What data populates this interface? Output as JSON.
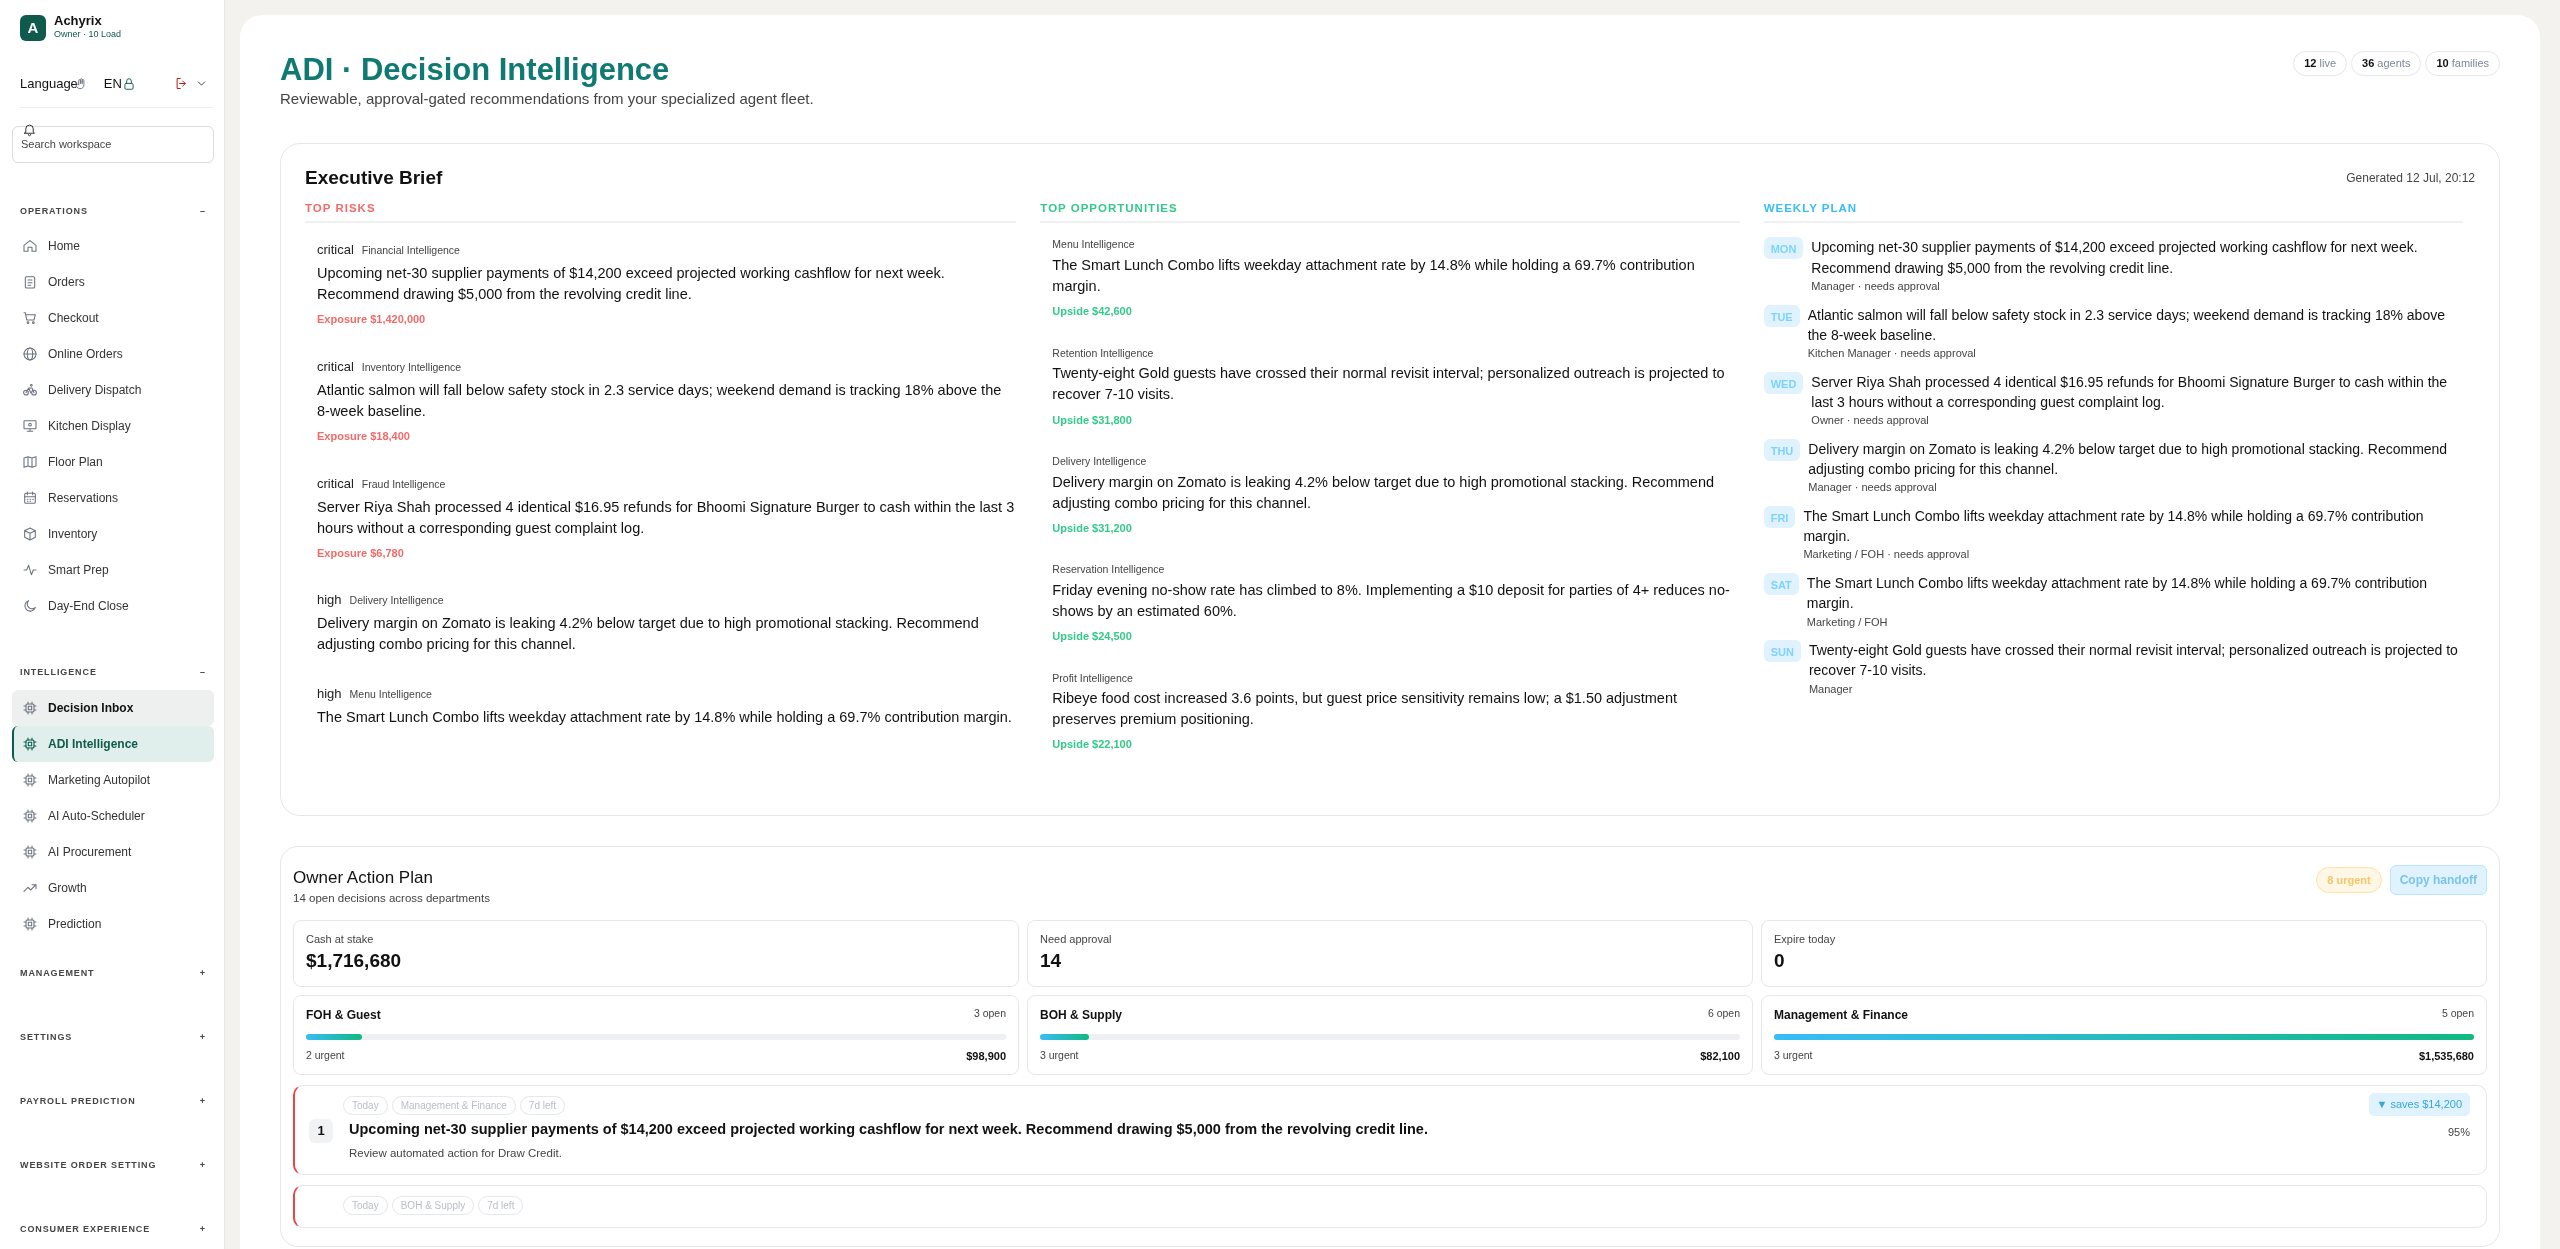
{
  "sidebar": {
    "brand": {
      "initial": "A",
      "name": "Achyrix",
      "subtitle": "Owner · 10 Load"
    },
    "language_label": "Language",
    "language_value": "EN",
    "search": {
      "placeholder": "Search workspace"
    },
    "sections": [
      {
        "title": "OPERATIONS",
        "toggle": "–",
        "items": [
          {
            "label": "Home",
            "kind": "home",
            "selected": false,
            "hovered": false
          },
          {
            "label": "Orders",
            "kind": "clipboard",
            "selected": false,
            "hovered": false
          },
          {
            "label": "Checkout",
            "kind": "cart",
            "selected": false,
            "hovered": false
          },
          {
            "label": "Online Orders",
            "kind": "globe",
            "selected": false,
            "hovered": false
          },
          {
            "label": "Delivery Dispatch",
            "kind": "bike",
            "selected": false,
            "hovered": false
          },
          {
            "label": "Kitchen Display",
            "kind": "monitor",
            "selected": false,
            "hovered": false
          },
          {
            "label": "Floor Plan",
            "kind": "map",
            "selected": false,
            "hovered": false
          },
          {
            "label": "Reservations",
            "kind": "calendar",
            "selected": false,
            "hovered": false
          },
          {
            "label": "Inventory",
            "kind": "box",
            "selected": false,
            "hovered": false
          },
          {
            "label": "Smart Prep",
            "kind": "pulse",
            "selected": false,
            "hovered": false
          },
          {
            "label": "Day-End Close",
            "kind": "moon",
            "selected": false,
            "hovered": false
          }
        ]
      },
      {
        "title": "INTELLIGENCE",
        "toggle": "–",
        "items": [
          {
            "label": "Decision Inbox",
            "kind": "chip",
            "selected": false,
            "hovered": true
          },
          {
            "label": "ADI Intelligence",
            "kind": "chip",
            "selected": true,
            "hovered": false
          },
          {
            "label": "Marketing Autopilot",
            "kind": "chip",
            "selected": false,
            "hovered": false
          },
          {
            "label": "AI Auto-Scheduler",
            "kind": "chip",
            "selected": false,
            "hovered": false
          },
          {
            "label": "AI Procurement",
            "kind": "chip",
            "selected": false,
            "hovered": false
          },
          {
            "label": "Growth",
            "kind": "trend",
            "selected": false,
            "hovered": false
          },
          {
            "label": "Prediction",
            "kind": "chip",
            "selected": false,
            "hovered": false
          }
        ]
      },
      {
        "title": "MANAGEMENT",
        "toggle": "+"
      },
      {
        "title": "SETTINGS",
        "toggle": "+"
      },
      {
        "title": "PAYROLL PREDICTION",
        "toggle": "+"
      },
      {
        "title": "WEBSITE ORDER SETTING",
        "toggle": "+"
      },
      {
        "title": "CONSUMER EXPERIENCE",
        "toggle": "+"
      }
    ]
  },
  "header": {
    "title": "ADI · Decision Intelligence",
    "subtitle": "Reviewable, approval-gated recommendations from your specialized agent fleet.",
    "stats": [
      {
        "value": "12",
        "label": "live"
      },
      {
        "value": "36",
        "label": "agents"
      },
      {
        "value": "10",
        "label": "families"
      }
    ]
  },
  "executive_brief": {
    "title": "Executive Brief",
    "generated": "Generated 12 Jul, 20:12",
    "top_risks": {
      "heading": "TOP RISKS",
      "items": [
        {
          "severity": "critical",
          "source": "Financial Intelligence",
          "text": "Upcoming net-30 supplier payments of $14,200 exceed projected working cashflow for next week. Recommend drawing $5,000 from the revolving credit line.",
          "metric": "Exposure $1,420,000"
        },
        {
          "severity": "critical",
          "source": "Inventory Intelligence",
          "text": "Atlantic salmon will fall below safety stock in 2.3 service days; weekend demand is tracking 18% above the 8-week baseline.",
          "metric": "Exposure $18,400"
        },
        {
          "severity": "critical",
          "source": "Fraud Intelligence",
          "text": "Server Riya Shah processed 4 identical $16.95 refunds for Bhoomi Signature Burger to cash within the last 3 hours without a corresponding guest complaint log.",
          "metric": "Exposure $6,780"
        },
        {
          "severity": "high",
          "source": "Delivery Intelligence",
          "text": "Delivery margin on Zomato is leaking 4.2% below target due to high promotional stacking. Recommend adjusting combo pricing for this channel."
        },
        {
          "severity": "high",
          "source": "Menu Intelligence",
          "text": "The Smart Lunch Combo lifts weekday attachment rate by 14.8% while holding a 69.7% contribution margin."
        }
      ]
    },
    "top_opportunities": {
      "heading": "TOP OPPORTUNITIES",
      "items": [
        {
          "source": "Menu Intelligence",
          "text": "The Smart Lunch Combo lifts weekday attachment rate by 14.8% while holding a 69.7% contribution margin.",
          "metric": "Upside $42,600"
        },
        {
          "source": "Retention Intelligence",
          "text": "Twenty-eight Gold guests have crossed their normal revisit interval; personalized outreach is projected to recover 7-10 visits.",
          "metric": "Upside $31,800"
        },
        {
          "source": "Delivery Intelligence",
          "text": "Delivery margin on Zomato is leaking 4.2% below target due to high promotional stacking. Recommend adjusting combo pricing for this channel.",
          "metric": "Upside $31,200"
        },
        {
          "source": "Reservation Intelligence",
          "text": "Friday evening no-show rate has climbed to 8%. Implementing a $10 deposit for parties of 4+ reduces no-shows by an estimated 60%.",
          "metric": "Upside $24,500"
        },
        {
          "source": "Profit Intelligence",
          "text": "Ribeye food cost increased 3.6 points, but guest price sensitivity remains low; a $1.50 adjustment preserves premium positioning.",
          "metric": "Upside $22,100"
        }
      ]
    },
    "weekly_plan": {
      "heading": "WEEKLY PLAN",
      "items": [
        {
          "day": "MON",
          "text": "Upcoming net-30 supplier payments of $14,200 exceed projected working cashflow for next week. Recommend drawing $5,000 from the revolving credit line.",
          "meta": "Manager · needs approval"
        },
        {
          "day": "TUE",
          "text": "Atlantic salmon will fall below safety stock in 2.3 service days; weekend demand is tracking 18% above the 8-week baseline.",
          "meta": "Kitchen Manager · needs approval"
        },
        {
          "day": "WED",
          "text": "Server Riya Shah processed 4 identical $16.95 refunds for Bhoomi Signature Burger to cash within the last 3 hours without a corresponding guest complaint log.",
          "meta": "Owner · needs approval"
        },
        {
          "day": "THU",
          "text": "Delivery margin on Zomato is leaking 4.2% below target due to high promotional stacking. Recommend adjusting combo pricing for this channel.",
          "meta": "Manager · needs approval"
        },
        {
          "day": "FRI",
          "text": "The Smart Lunch Combo lifts weekday attachment rate by 14.8% while holding a 69.7% contribution margin.",
          "meta": "Marketing / FOH · needs approval"
        },
        {
          "day": "SAT",
          "text": "The Smart Lunch Combo lifts weekday attachment rate by 14.8% while holding a 69.7% contribution margin.",
          "meta": "Marketing / FOH"
        },
        {
          "day": "SUN",
          "text": "Twenty-eight Gold guests have crossed their normal revisit interval; personalized outreach is projected to recover 7-10 visits.",
          "meta": "Manager"
        }
      ]
    }
  },
  "owner_action_plan": {
    "title": "Owner Action Plan",
    "subtitle": "14 open decisions across departments",
    "urgent_badge": "8 urgent",
    "copy_button": "Copy handoff",
    "kpis": [
      {
        "label": "Cash at stake",
        "value": "$1,716,680"
      },
      {
        "label": "Need approval",
        "value": "14"
      },
      {
        "label": "Expire today",
        "value": "0"
      }
    ],
    "departments": [
      {
        "name": "FOH & Guest",
        "open": "3 open",
        "level": 0.08,
        "urgent": "2 urgent",
        "amount": "$98,900"
      },
      {
        "name": "BOH & Supply",
        "open": "6 open",
        "level": 0.07,
        "urgent": "3 urgent",
        "amount": "$82,100"
      },
      {
        "name": "Management & Finance",
        "open": "5 open",
        "level": 1.0,
        "urgent": "3 urgent",
        "amount": "$1,535,680"
      }
    ],
    "actions": [
      {
        "number": "1",
        "chips": [
          "Today",
          "Management & Finance",
          "7d left"
        ],
        "title": "Upcoming net-30 supplier payments of $14,200 exceed projected working cashflow for next week. Recommend drawing $5,000 from the revolving credit line.",
        "detail": "Review automated action for Draw Credit.",
        "savings": "▼ saves $14,200",
        "confidence": "95%"
      },
      {
        "chips": [
          "Today",
          "BOH & Supply",
          "7d left"
        ]
      }
    ]
  }
}
